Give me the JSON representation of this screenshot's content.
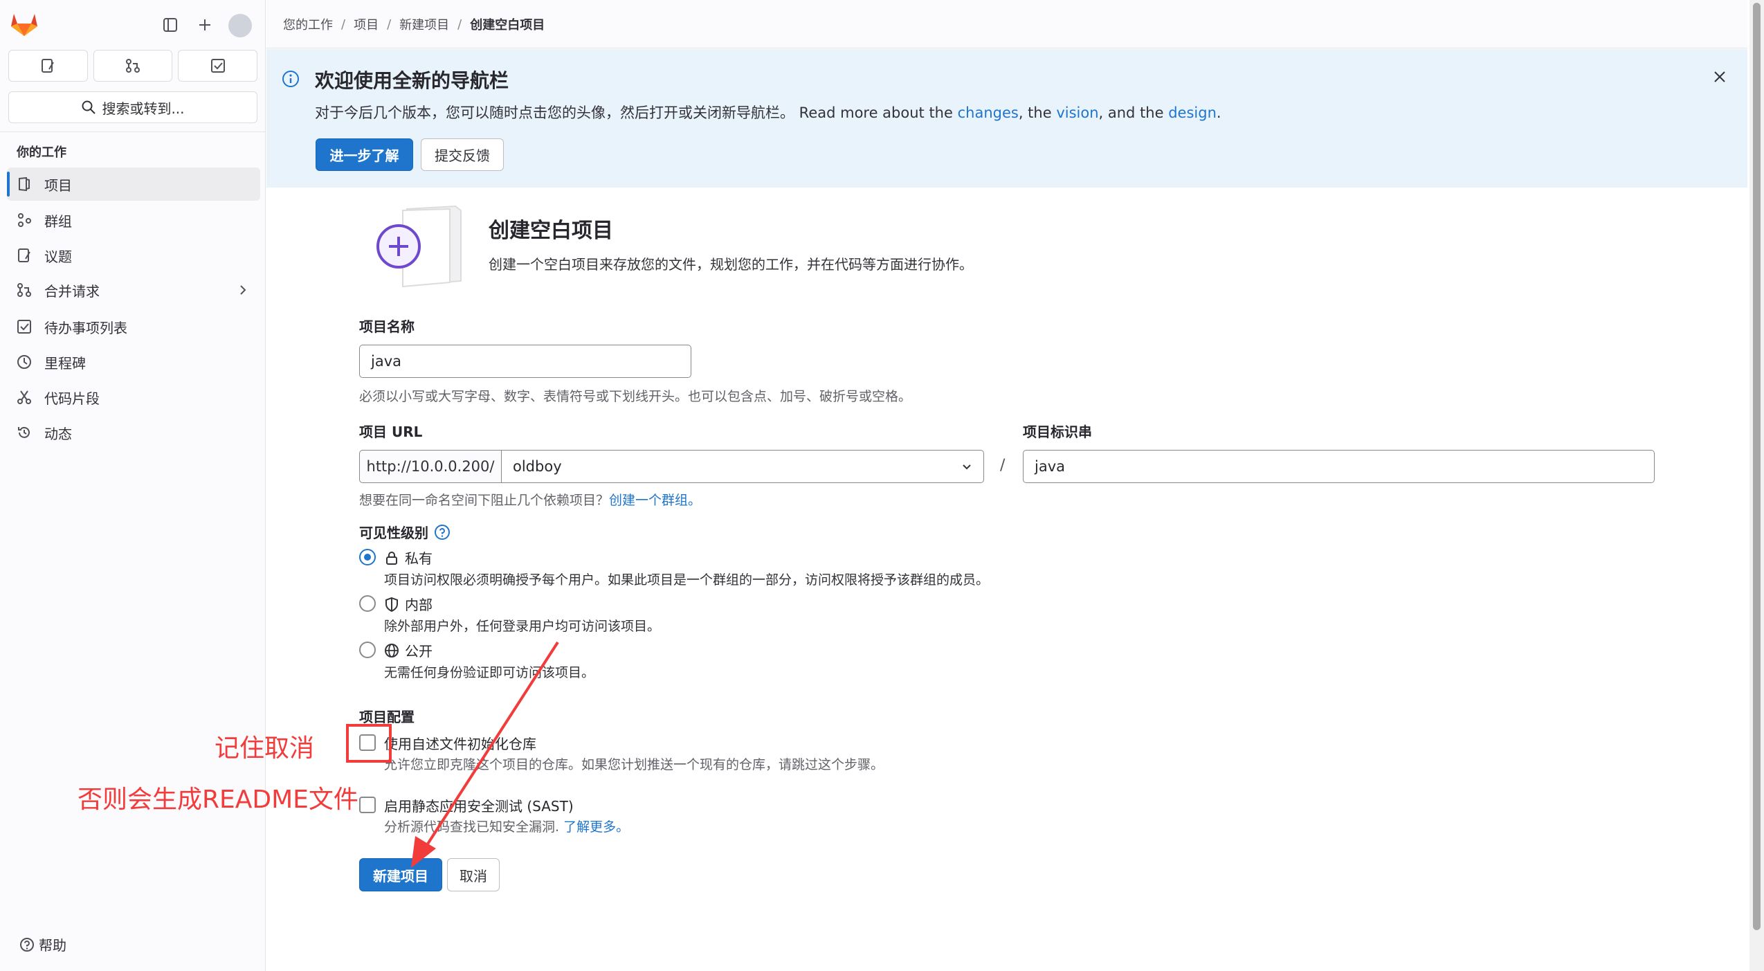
{
  "sidebar": {
    "search_label": "搜索或转到...",
    "section_title": "你的工作",
    "items": [
      {
        "label": "项目",
        "icon": "project-icon"
      },
      {
        "label": "群组",
        "icon": "group-icon"
      },
      {
        "label": "议题",
        "icon": "issues-icon"
      },
      {
        "label": "合并请求",
        "icon": "merge-request-icon"
      },
      {
        "label": "待办事项列表",
        "icon": "todo-icon"
      },
      {
        "label": "里程碑",
        "icon": "clock-icon"
      },
      {
        "label": "代码片段",
        "icon": "snippet-icon"
      },
      {
        "label": "动态",
        "icon": "history-icon"
      }
    ],
    "help_label": "帮助"
  },
  "breadcrumb": {
    "items": [
      "您的工作",
      "项目",
      "新建项目"
    ],
    "current": "创建空白项目"
  },
  "banner": {
    "title": "欢迎使用全新的导航栏",
    "text_prefix": "对于今后几个版本，您可以随时点击您的头像，然后打开或关闭新导航栏。 Read more about the ",
    "link_changes": "changes",
    "text_mid1": ", the ",
    "link_vision": "vision",
    "text_mid2": ", and the ",
    "link_design": "design",
    "text_end": ".",
    "learn_more_button": "进一步了解",
    "feedback_button": "提交反馈"
  },
  "page": {
    "title": "创建空白项目",
    "description": "创建一个空白项目来存放您的文件，规划您的工作，并在代码等方面进行协作。"
  },
  "form": {
    "project_name_label": "项目名称",
    "project_name_value": "java",
    "project_name_help": "必须以小写或大写字母、数字、表情符号或下划线开头。也可以包含点、加号、破折号或空格。",
    "project_url_label": "项目 URL",
    "url_prefix": "http://10.0.0.200/",
    "namespace_value": "oldboy",
    "slug_label": "项目标识串",
    "slug_value": "java",
    "slash": "/",
    "group_help_prefix": "想要在同一命名空间下阻止几个依赖项目？",
    "group_help_link": "创建一个群组。",
    "visibility_label": "可见性级别",
    "visibility_options": [
      {
        "label": "私有",
        "icon": "lock-icon",
        "description": "项目访问权限必须明确授予每个用户。如果此项目是一个群组的一部分，访问权限将授予该群组的成员。",
        "checked": true
      },
      {
        "label": "内部",
        "icon": "shield-icon",
        "description": "除外部用户外，任何登录用户均可访问该项目。",
        "checked": false
      },
      {
        "label": "公开",
        "icon": "globe-icon",
        "description": "无需任何身份验证即可访问该项目。",
        "checked": false
      }
    ],
    "config_label": "项目配置",
    "config_options": [
      {
        "label": "使用自述文件初始化仓库",
        "description": "允许您立即克隆这个项目的仓库。如果您计划推送一个现有的仓库，请跳过这个步骤。",
        "checked": false
      },
      {
        "label": "启用静态应用安全测试 (SAST)",
        "description": "分析源代码查找已知安全漏洞. ",
        "link": "了解更多。",
        "checked": false
      }
    ],
    "create_button": "新建项目",
    "cancel_button": "取消"
  },
  "annotations": {
    "note1": "记住取消",
    "note2": "否则会生成README文件",
    "color": "#f23c3c"
  }
}
